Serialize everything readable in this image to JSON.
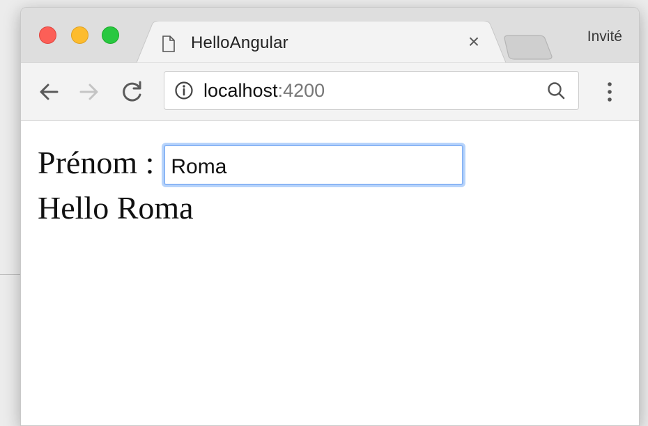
{
  "browser": {
    "tab_title": "HelloAngular",
    "tab_close": "×",
    "profile_label": "Invité",
    "url_host": "localhost",
    "url_port": ":4200"
  },
  "icons": {
    "close_window": "traffic-light-close",
    "minimize_window": "traffic-light-minimize",
    "maximize_window": "traffic-light-maximize",
    "tab_page": "page-icon",
    "back": "arrow-left-icon",
    "forward": "arrow-right-icon",
    "reload": "reload-icon",
    "site_info": "info-icon",
    "search": "search-icon",
    "menu": "kebab-menu-icon"
  },
  "colors": {
    "close": "#fc5f57",
    "minimize": "#fdbc2e",
    "maximize": "#28c840",
    "focus_ring": "#8bb6f5"
  },
  "page": {
    "prenom_label": "Prénom :",
    "name_value": "Roma",
    "greeting": "Hello Roma"
  }
}
